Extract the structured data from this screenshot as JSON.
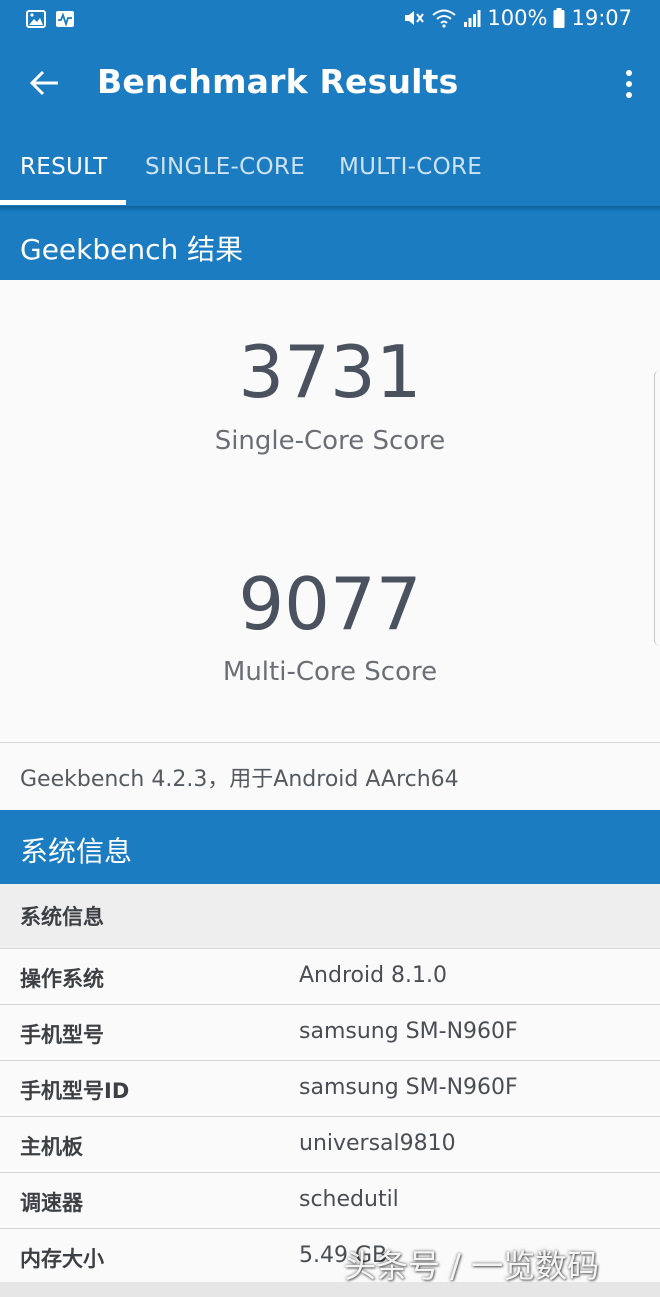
{
  "status_bar": {
    "battery": "100%",
    "time": "19:07"
  },
  "app_bar": {
    "title": "Benchmark Results"
  },
  "tabs": [
    {
      "label": "RESULT",
      "active": true
    },
    {
      "label": "SINGLE-CORE",
      "active": false
    },
    {
      "label": "MULTI-CORE",
      "active": false
    }
  ],
  "results": {
    "section_title": "Geekbench 结果",
    "single_core_score": "3731",
    "single_core_label": "Single-Core Score",
    "multi_core_score": "9077",
    "multi_core_label": "Multi-Core Score",
    "version_text": "Geekbench 4.2.3，用于Android AArch64"
  },
  "system_info": {
    "section_title": "系统信息",
    "table_header": "系统信息",
    "rows": [
      {
        "key": "操作系统",
        "value": "Android 8.1.0"
      },
      {
        "key": "手机型号",
        "value": "samsung SM-N960F"
      },
      {
        "key": "手机型号ID",
        "value": "samsung SM-N960F"
      },
      {
        "key": "主机板",
        "value": "universal9810"
      },
      {
        "key": "调速器",
        "value": "schedutil"
      },
      {
        "key": "内存大小",
        "value": "5.49 GB"
      }
    ]
  },
  "watermark": "头条号 / 一览数码",
  "colors": {
    "primary": "#1b7cc2",
    "score_text": "#4a5260",
    "background": "#fafafa"
  }
}
